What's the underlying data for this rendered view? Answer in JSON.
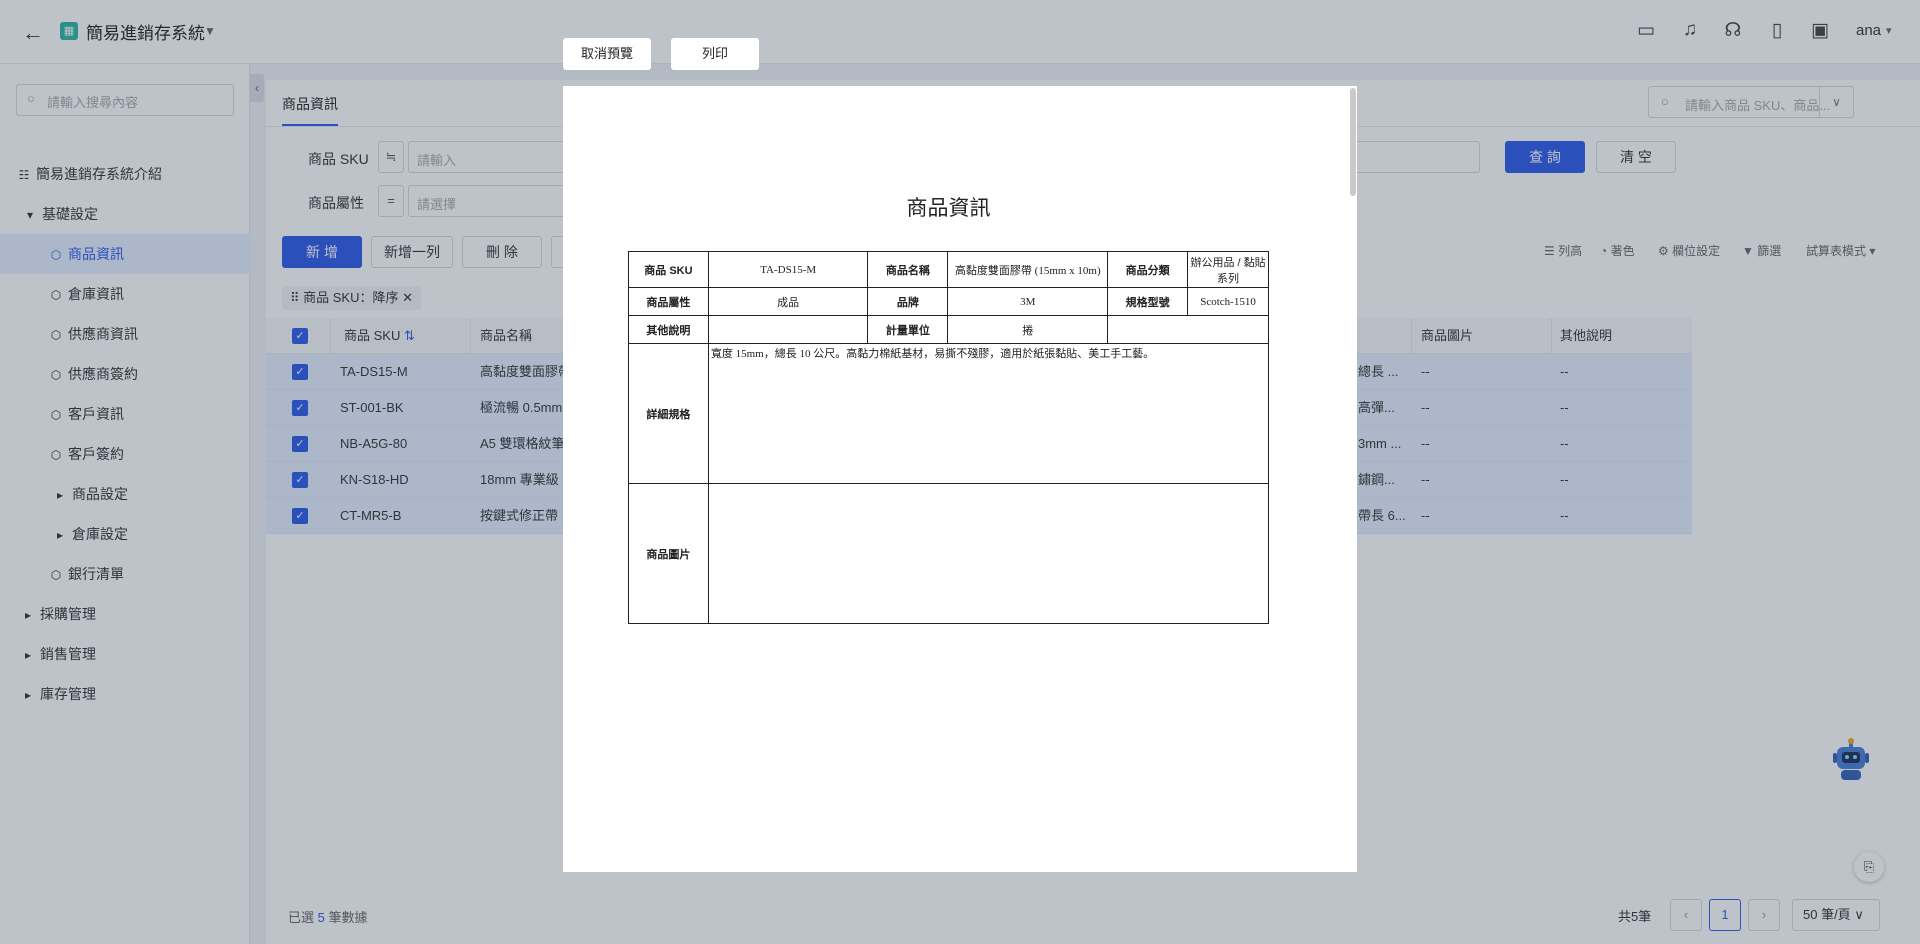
{
  "topbar": {
    "app_title": "簡易進銷存系統",
    "user": "ana",
    "icons": [
      "monitor-icon",
      "bell-icon",
      "headset-icon",
      "book-icon",
      "image-edit-icon"
    ]
  },
  "sidebar": {
    "search_placeholder": "請輸入搜尋內容",
    "items": [
      {
        "label": "簡易進銷存系統介紹",
        "icon": "table-icon"
      },
      {
        "label": "基礎設定",
        "icon": "caret-down-icon"
      },
      {
        "label": "商品資訊",
        "icon": "cube-icon",
        "active": true
      },
      {
        "label": "倉庫資訊",
        "icon": "cube-icon"
      },
      {
        "label": "供應商資訊",
        "icon": "cube-icon"
      },
      {
        "label": "供應商簽約",
        "icon": "cube-icon"
      },
      {
        "label": "客戶資訊",
        "icon": "cube-icon"
      },
      {
        "label": "客戶簽約",
        "icon": "cube-icon"
      },
      {
        "label": "商品設定",
        "icon": "caret-right-icon"
      },
      {
        "label": "倉庫設定",
        "icon": "caret-right-icon"
      },
      {
        "label": "銀行清單",
        "icon": "cube-icon"
      },
      {
        "label": "採購管理",
        "icon": "caret-right-icon"
      },
      {
        "label": "銷售管理",
        "icon": "caret-right-icon"
      },
      {
        "label": "庫存管理",
        "icon": "caret-right-icon"
      }
    ]
  },
  "content": {
    "tab": "商品資訊",
    "right_search_placeholder": "請輸入商品 SKU、商品...",
    "filters": {
      "sku_label": "商品 SKU",
      "sku_placeholder": "請輸入",
      "attr_label": "商品屬性",
      "attr_placeholder": "請選擇",
      "op1": "≒",
      "op2": "="
    },
    "buttons": {
      "query": "查 詢",
      "clear": "清 空",
      "add": "新 增",
      "add_row": "新增一列",
      "delete": "刪 除"
    },
    "toolbar_right": [
      "列高",
      "著色",
      "欄位設定",
      "篩選",
      "試算表模式"
    ],
    "sort_chip": "商品 SKU：降序",
    "columns": {
      "sku": "商品 SKU",
      "name": "商品名稱",
      "image": "商品圖片",
      "notes": "其他說明"
    },
    "rows": [
      {
        "sku": "TA-DS15-M",
        "name": "高黏度雙面膠帶",
        "spec_tail": "總長 ...",
        "image": "--",
        "notes": "--"
      },
      {
        "sku": "ST-001-BK",
        "name": "極流暢 0.5mm",
        "spec_tail": "高彈...",
        "image": "--",
        "notes": "--"
      },
      {
        "sku": "NB-A5G-80",
        "name": "A5 雙環格紋筆",
        "spec_tail": "3mm ...",
        "image": "--",
        "notes": "--"
      },
      {
        "sku": "KN-S18-HD",
        "name": "18mm 專業級",
        "spec_tail": "鏽鋼...",
        "image": "--",
        "notes": "--"
      },
      {
        "sku": "CT-MR5-B",
        "name": "按鍵式修正帶",
        "spec_tail": "帶長 6...",
        "image": "--",
        "notes": "--"
      }
    ],
    "footer": {
      "selected_prefix": "已選",
      "selected_count": "5",
      "selected_suffix": "筆數據",
      "total": "共5筆",
      "page": "1",
      "page_size": "50 筆/頁"
    }
  },
  "preview": {
    "cancel": "取消預覽",
    "print": "列印",
    "title": "商品資訊",
    "labels": {
      "sku": "商品 SKU",
      "name": "商品名稱",
      "category": "商品分類",
      "attr": "商品屬性",
      "brand": "品牌",
      "model": "規格型號",
      "notes": "其他說明",
      "unit": "計量單位",
      "detail": "詳細規格",
      "image": "商品圖片"
    },
    "values": {
      "sku": "TA-DS15-M",
      "name": "高黏度雙面膠帶 (15mm x 10m)",
      "category": "辦公用品 / 黏貼系列",
      "attr": "成品",
      "brand": "3M",
      "model": "Scotch-1510",
      "notes": "",
      "unit": "捲",
      "detail": "寬度 15mm，總長 10 公尺。高黏力棉紙基材，易撕不殘膠，適用於紙張黏貼、美工手工藝。",
      "image": ""
    }
  }
}
